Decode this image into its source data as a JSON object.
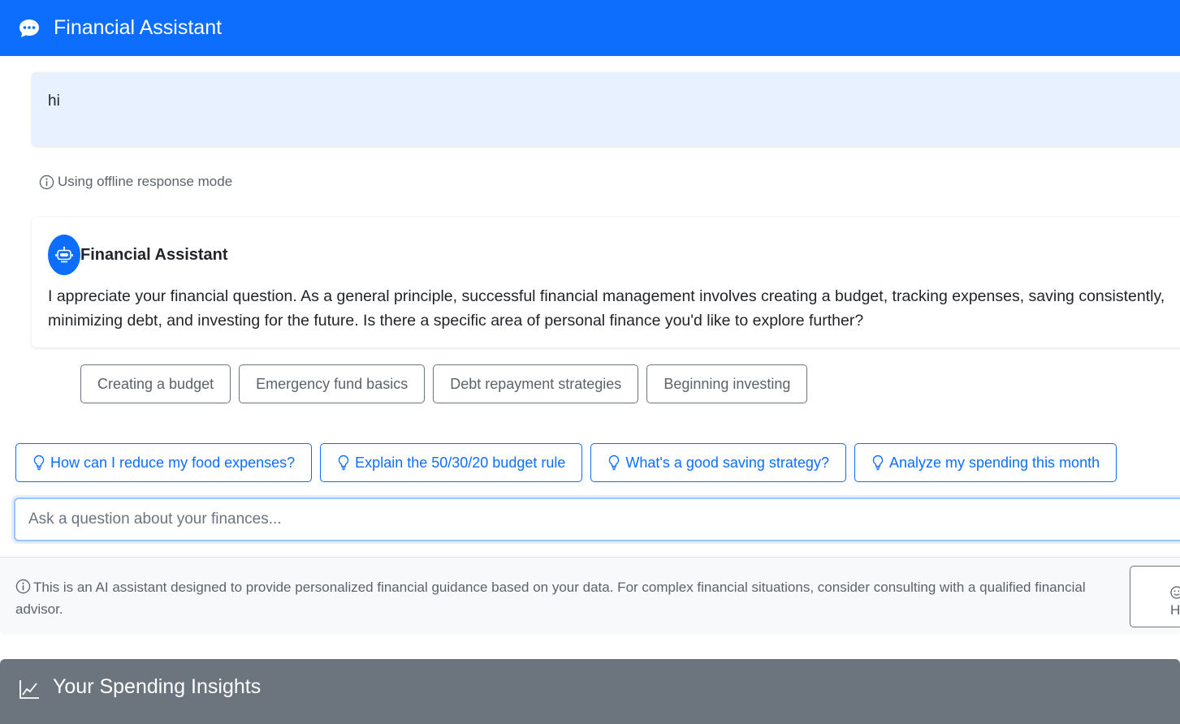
{
  "header": {
    "title": "Financial Assistant",
    "icon": "chat-dots-icon",
    "bg_color": "#0d6efd"
  },
  "user_message": {
    "text": "hi"
  },
  "notice": {
    "text": "Using offline response mode",
    "icon": "info-circle-icon"
  },
  "assistant_message": {
    "name": "Financial Assistant",
    "avatar_icon": "robot-icon",
    "text": "I appreciate your financial question. As a general principle, successful financial management involves creating a budget, tracking expenses, saving consistently, minimizing debt, and investing for the future. Is there a specific area of personal finance you'd like to explore further?"
  },
  "topics": [
    {
      "label": "Creating a budget"
    },
    {
      "label": "Emergency fund basics"
    },
    {
      "label": "Debt repayment strategies"
    },
    {
      "label": "Beginning investing"
    }
  ],
  "suggestions": [
    {
      "label": "How can I reduce my food expenses?",
      "icon": "lightbulb-icon"
    },
    {
      "label": "Explain the 50/30/20 budget rule",
      "icon": "lightbulb-icon"
    },
    {
      "label": "What's a good saving strategy?",
      "icon": "lightbulb-icon"
    },
    {
      "label": "Analyze my spending this month",
      "icon": "lightbulb-icon"
    }
  ],
  "input": {
    "placeholder": "Ask a question about your finances...",
    "value": ""
  },
  "footer": {
    "disclaimer": "This is an AI assistant designed to provide personalized financial guidance based on your data. For complex financial situations, consider consulting with a qualified financial advisor.",
    "help_label": "H",
    "help_icon": "emoji-smile-icon"
  },
  "insights": {
    "title": "Your Spending Insights",
    "icon": "graph-up-icon",
    "bg_color": "#6c757d"
  }
}
